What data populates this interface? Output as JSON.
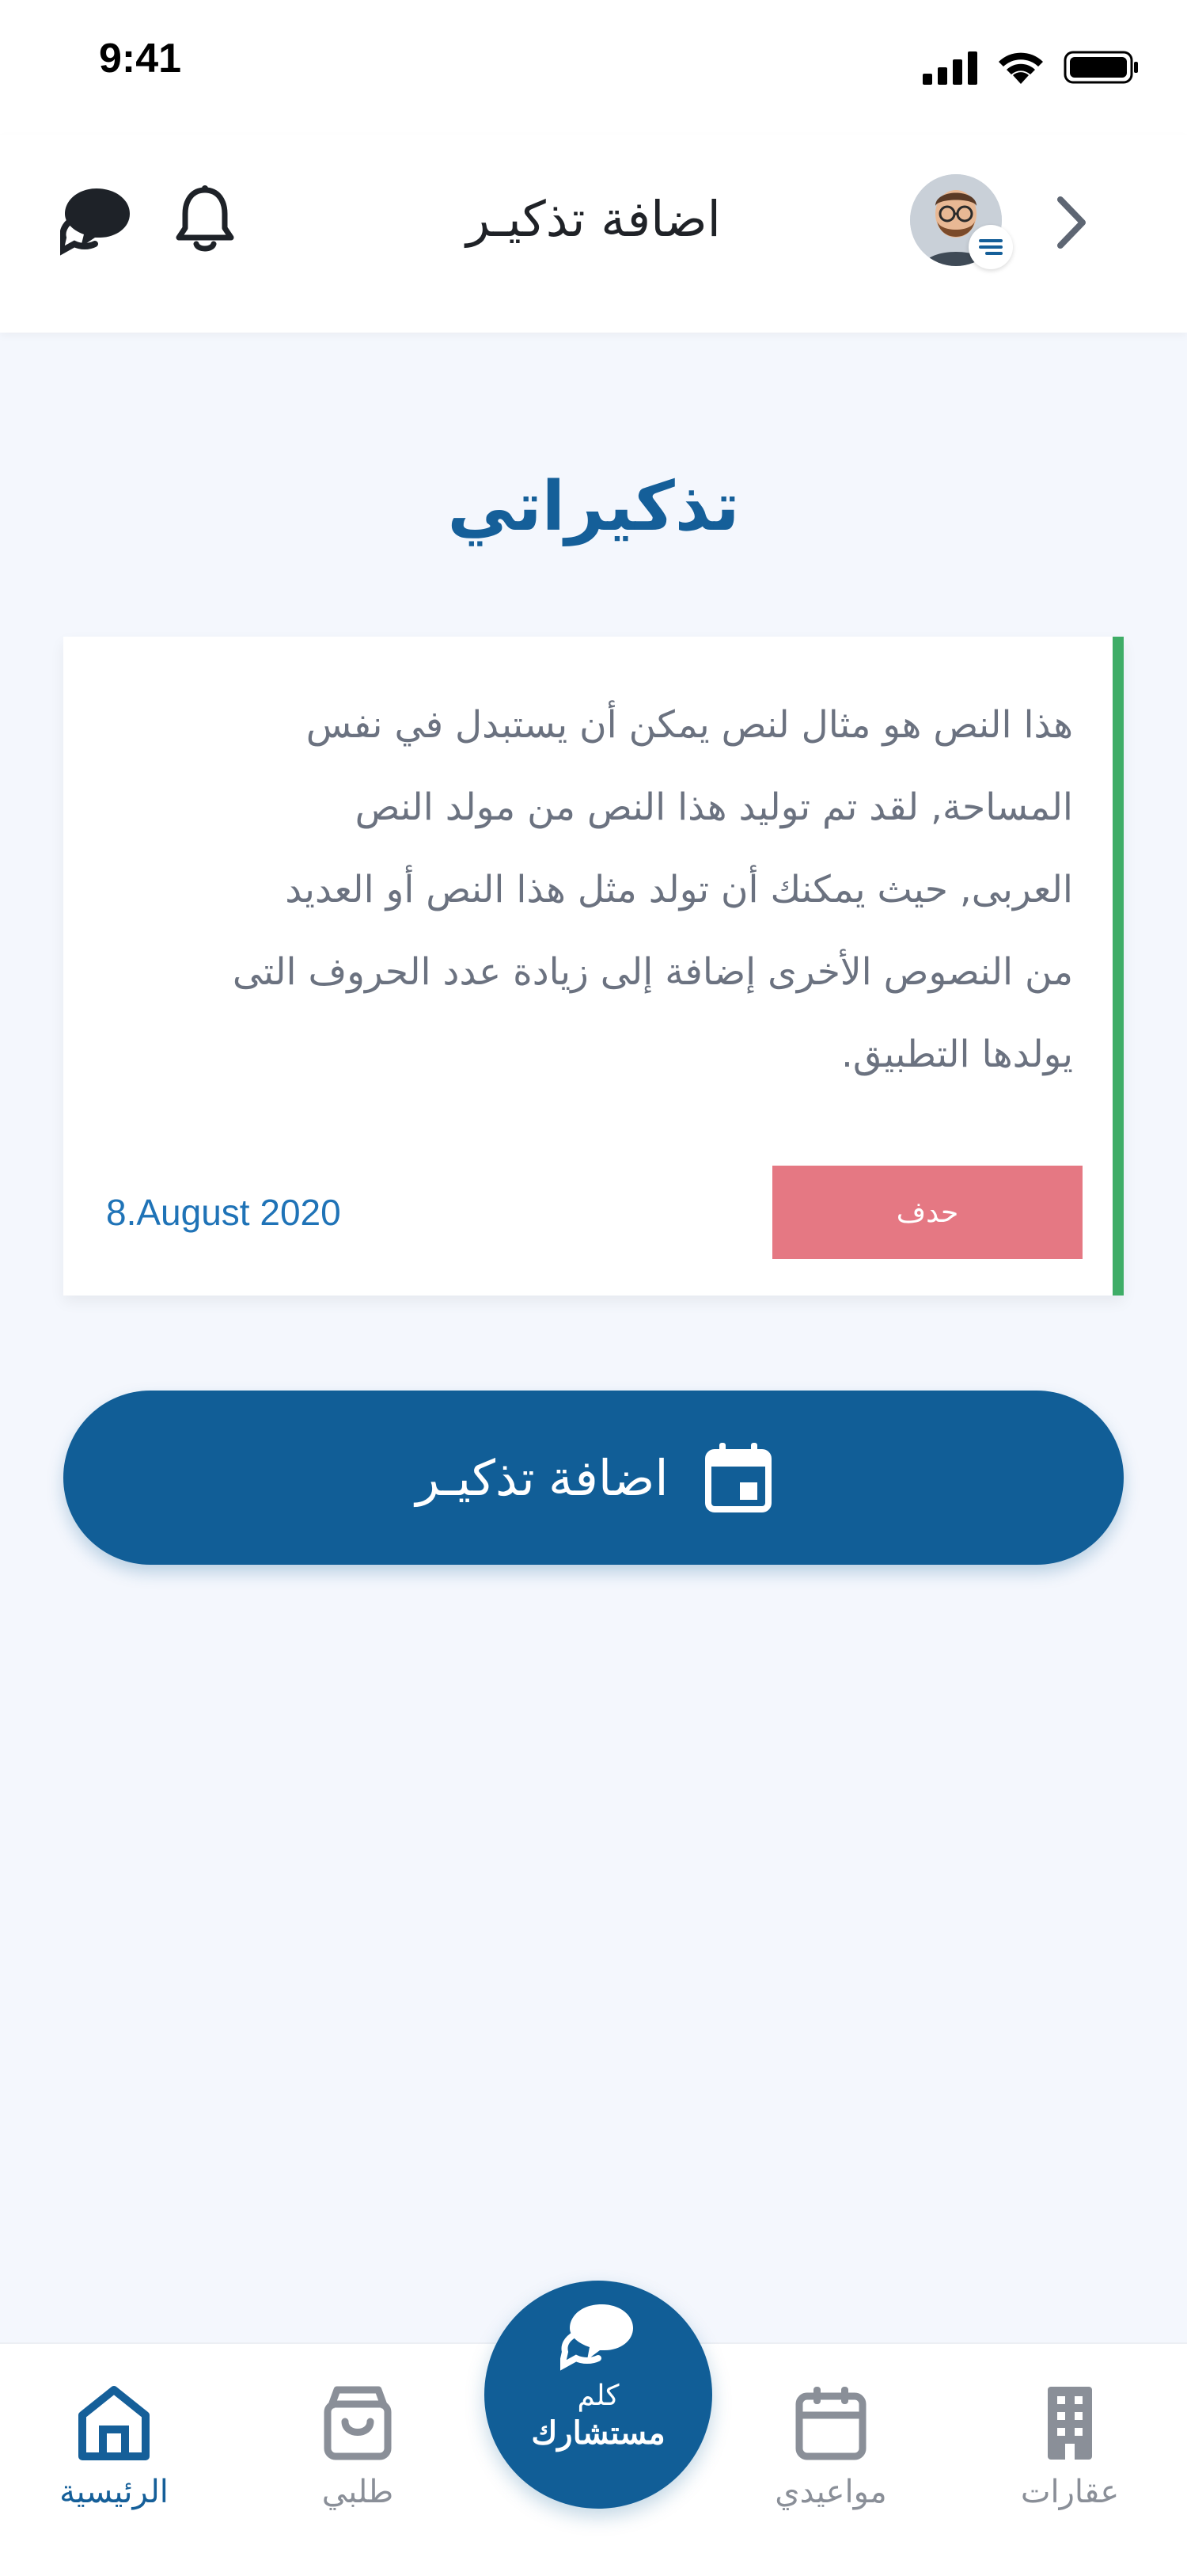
{
  "status_bar": {
    "time": "9:41"
  },
  "header": {
    "title": "اضافة تذكيـر"
  },
  "page": {
    "heading": "تذكيراتي"
  },
  "reminder": {
    "lines": [
      "هذا النص هو مثال لنص يمكن أن يستبدل في نفس",
      "المساحة, لقد تم توليد هذا النص من مولد النص",
      "العربى, حيث يمكنك أن تولد مثل هذا النص أو العديد",
      "من النصوص الأخرى إضافة إلى زيادة عدد الحروف التى",
      "يولدها التطبيق."
    ],
    "date": "8.August 2020",
    "delete_label": "حدف",
    "accent_color": "#3fad67"
  },
  "add_button": {
    "label": "اضافة تذكيـر",
    "icon": "calendar-icon"
  },
  "bottom_nav": {
    "items": [
      {
        "label": "الرئيسية",
        "icon": "home-icon",
        "active": true
      },
      {
        "label": "طلبي",
        "icon": "shopping-bag-icon",
        "active": false
      },
      {
        "label": "مواعيدي",
        "icon": "calendar-icon",
        "active": false
      },
      {
        "label": "عقارات",
        "icon": "building-icon",
        "active": false
      }
    ],
    "center": {
      "line1": "كلم",
      "line2": "مستشارك",
      "icon": "chat-bubbles-icon"
    }
  },
  "colors": {
    "primary": "#115e97",
    "heading": "#155f99",
    "delete": "#e57883",
    "background": "#f4f7fd"
  }
}
